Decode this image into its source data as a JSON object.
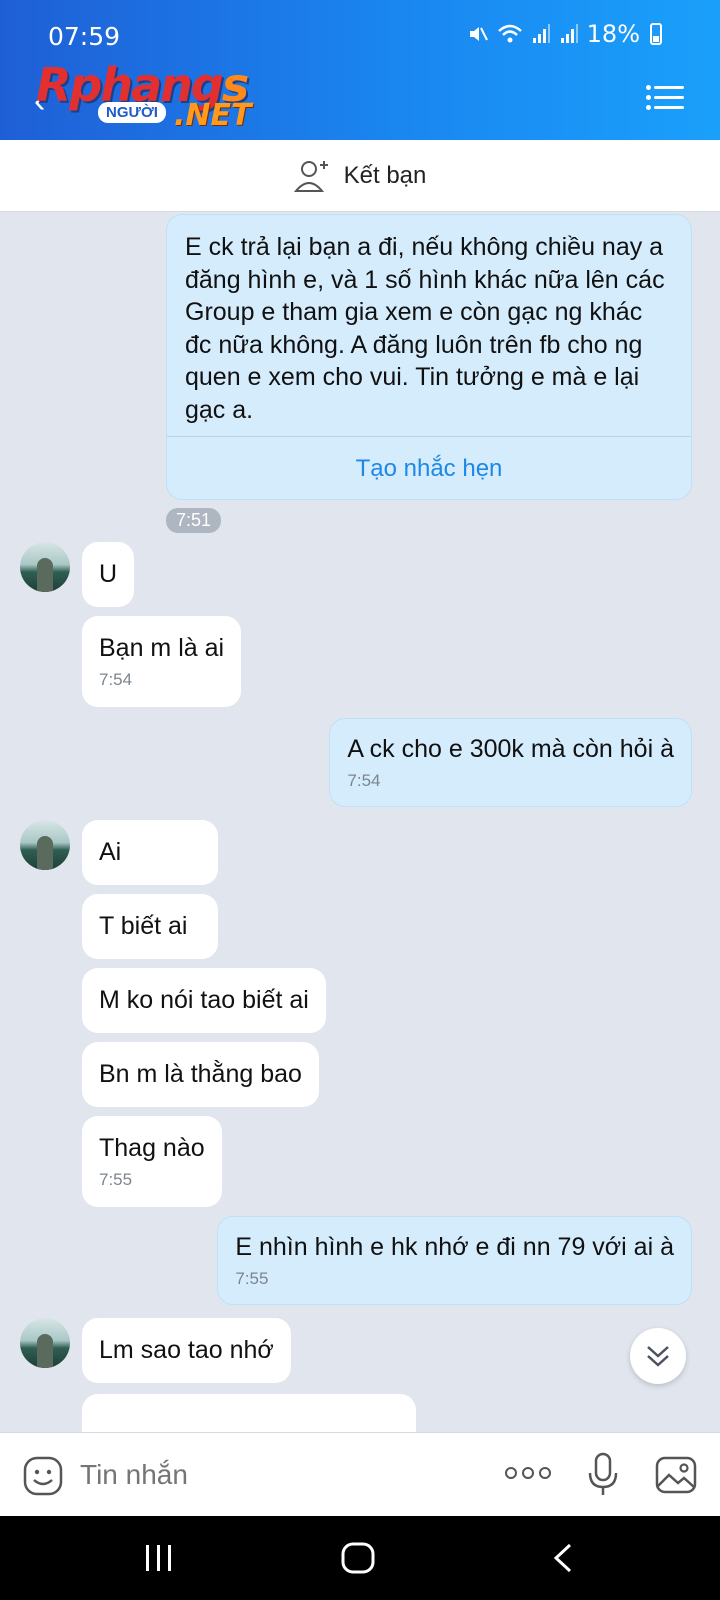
{
  "status_bar": {
    "time": "07:59",
    "battery": "18%",
    "icons": [
      "mute-icon",
      "wifi-icon",
      "signal-icon",
      "signal-icon",
      "battery-icon"
    ]
  },
  "app_bar": {
    "logo_main": "Rphang",
    "logo_s": "s",
    "logo_pill": "NGƯỜI",
    "logo_net": ".NET"
  },
  "friend_bar": {
    "label": "Kết bạn"
  },
  "messages": {
    "m1": {
      "text": "E ck trả lại bạn a đi, nếu không chiều nay a đăng hình e, và 1 số hình khác nữa lên các Group e tham gia xem e còn gạc ng khác đc nữa không. A đăng luôn trên fb cho ng quen e xem cho vui. Tin tưởng e mà e lại gạc a.",
      "action": "Tạo nhắc hẹn"
    },
    "time_pill": "7:51",
    "m2": {
      "text": "U"
    },
    "m3": {
      "text": "Bạn m là ai",
      "time": "7:54"
    },
    "m4": {
      "text": "A ck cho e 300k mà còn hỏi à",
      "time": "7:54"
    },
    "m5": {
      "text": "Ai"
    },
    "m6": {
      "text": "T biết ai"
    },
    "m7": {
      "text": "M ko nói tao biết ai"
    },
    "m8": {
      "text": "Bn m là thằng bao"
    },
    "m9": {
      "text": "Thag nào",
      "time": "7:55"
    },
    "m10": {
      "text": "E nhìn hình e hk nhớ e đi nn 79 với ai à",
      "time": "7:55"
    },
    "m11": {
      "text": "Lm sao tao nhớ"
    }
  },
  "input": {
    "placeholder": "Tin nhắn"
  },
  "colors": {
    "header_start": "#1f5fd6",
    "header_end": "#1aa0fb",
    "outgoing_bubble": "#d5ecfc",
    "incoming_bubble": "#ffffff",
    "chat_background": "#e1e6ee",
    "link": "#1e88e5"
  }
}
